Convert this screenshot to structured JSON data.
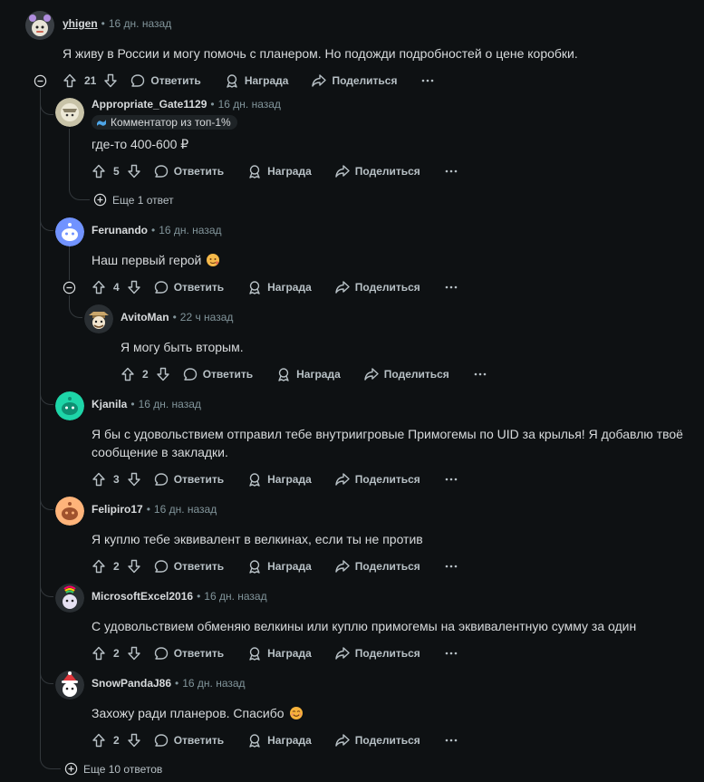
{
  "action_labels": {
    "reply": "Ответить",
    "award": "Награда",
    "share": "Поделиться"
  },
  "root": {
    "user": "yhigen",
    "dot": "•",
    "time": "16 дн. назад",
    "text": "Я живу в России и могу помочь с планером. Но подожди подробностей о цене коробки.",
    "score": "21"
  },
  "replies": [
    {
      "user": "Appropriate_Gate1129",
      "time": "16 дн. назад",
      "flair": "Комментатор из топ-1%",
      "text": "где-то 400-600 ₽",
      "score": "5",
      "more": "Еще 1 ответ"
    },
    {
      "user": "Ferunando",
      "time": "16 дн. назад",
      "text": "Наш первый герой",
      "score": "4"
    },
    {
      "user": "Kjanila",
      "time": "16 дн. назад",
      "text_l1": "Я бы с удовольствием отправил тебе внутриигровые Примогемы по UID за крылья! Я добавлю твоё",
      "text_l2": "сообщение в закладки.",
      "score": "3"
    },
    {
      "user": "Felipiro17",
      "time": "16 дн. назад",
      "text": "Я куплю тебе эквивалент в велкинах, если ты не против",
      "score": "2"
    },
    {
      "user": "MicrosoftExcel2016",
      "time": "16 дн. назад",
      "text": "С удовольствием обменяю велкины или куплю примогемы на эквивалентную сумму за один",
      "score": "2"
    },
    {
      "user": "SnowPandaJ86",
      "time": "16 дн. назад",
      "text": "Захожу ради планеров. Спасибо",
      "score": "2"
    }
  ],
  "nested": {
    "user": "AvitoMan",
    "time": "22 ч назад",
    "text": "Я могу быть вторым.",
    "score": "2"
  },
  "root_more": "Еще 10 ответов",
  "colors": {
    "bg": "#0e1113",
    "text": "#d7dadc",
    "muted": "#82959b",
    "thread": "#33383c"
  }
}
